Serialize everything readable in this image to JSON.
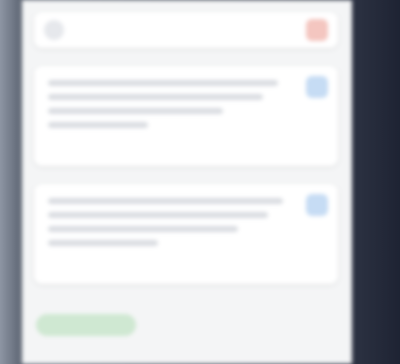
{
  "header": {
    "title": ""
  },
  "cards": [
    {
      "footer": ""
    },
    {
      "footer": ""
    }
  ],
  "action": {
    "label": ""
  }
}
